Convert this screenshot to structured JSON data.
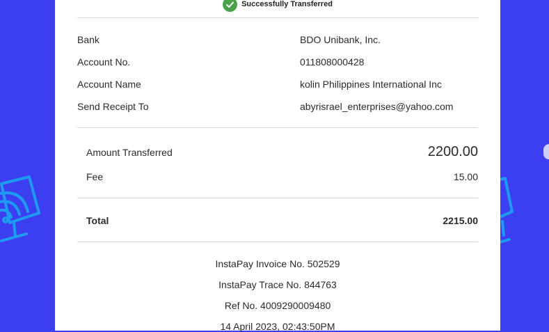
{
  "status": {
    "text": "Successfully Transferred",
    "icon": "check-circle-icon",
    "color": "#4aa34a"
  },
  "details": [
    {
      "label": "Bank",
      "value": "BDO Unibank, Inc."
    },
    {
      "label": "Account No.",
      "value": "011808000428"
    },
    {
      "label": "Account Name",
      "value": "kolin Philippines International Inc"
    },
    {
      "label": "Send Receipt To",
      "value": "abyrisrael_enterprises@yahoo.com"
    }
  ],
  "amounts": {
    "transferred_label": "Amount Transferred",
    "transferred_value": "2200.00",
    "fee_label": "Fee",
    "fee_value": "15.00",
    "total_label": "Total",
    "total_value": "2215.00"
  },
  "footer": {
    "invoice": "InstaPay Invoice No. 502529",
    "trace": "InstaPay Trace No. 844763",
    "ref": "Ref No. 4009290009480",
    "datetime": "14 April 2023, 02:43:50PM"
  },
  "colors": {
    "background": "#3b3ff0",
    "card": "#ffffff",
    "decoration": "#1e9bf0"
  }
}
